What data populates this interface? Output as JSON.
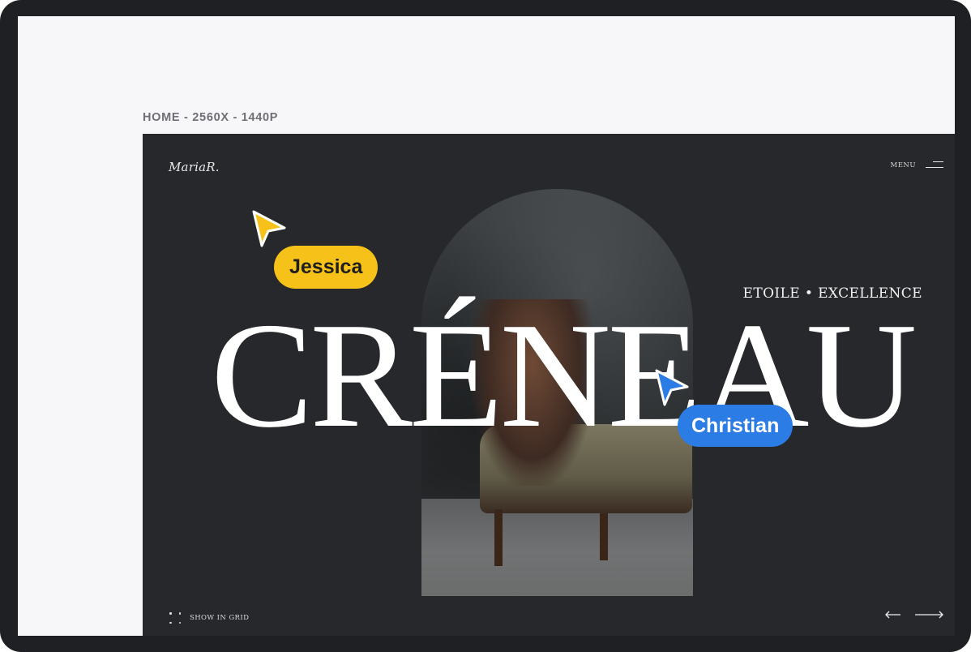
{
  "canvas": {
    "frame_label": "HOME - 2560X - 1440P"
  },
  "site": {
    "logo": "MariaR.",
    "menu_label": "MENU",
    "tagline": "ETOILE • EXCELLENCE",
    "headline": "CRÉNEAU",
    "show_grid_label": "SHOW IN GRID"
  },
  "collaborators": [
    {
      "name": "Jessica",
      "color": "#F6C21A"
    },
    {
      "name": "Christian",
      "color": "#2B7CE4"
    }
  ],
  "icons": {
    "menu": "hamburger-icon",
    "grid": "grid-dots-icon",
    "prev": "arrow-left-icon",
    "next": "arrow-right-icon",
    "cursor": "pointer-cursor-icon"
  },
  "colors": {
    "device_frame": "#1F2023",
    "canvas_bg": "#F7F6F9",
    "site_bg": "#27282B",
    "text_light": "#FFFFFF"
  }
}
